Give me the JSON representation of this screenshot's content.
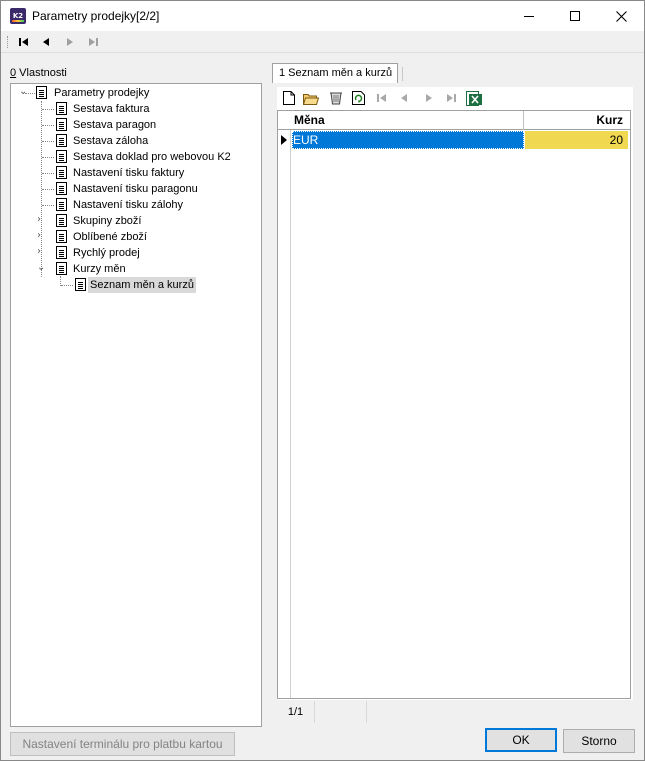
{
  "window": {
    "icon_text": "K2",
    "title": "Parametry prodejky[2/2]"
  },
  "left_panel": {
    "label_accel": "0",
    "label_rest": " Vlastnosti",
    "tree": [
      {
        "label": "Parametry prodejky"
      },
      {
        "label": "Sestava faktura"
      },
      {
        "label": "Sestava paragon"
      },
      {
        "label": "Sestava záloha"
      },
      {
        "label": "Sestava doklad pro webovou K2"
      },
      {
        "label": "Nastavení tisku faktury"
      },
      {
        "label": "Nastavení tisku paragonu"
      },
      {
        "label": "Nastavení tisku zálohy"
      },
      {
        "label": "Skupiny zboží"
      },
      {
        "label": "Oblíbené zboží"
      },
      {
        "label": "Rychlý prodej"
      },
      {
        "label": "Kurzy měn"
      },
      {
        "label": "Seznam měn a kurzů"
      }
    ]
  },
  "tab": {
    "label": "1 Seznam měn a kurzů"
  },
  "grid": {
    "columns": [
      "Měna",
      "Kurz"
    ],
    "rows": [
      {
        "mena": "EUR",
        "kurz": "20"
      }
    ],
    "accent_color": "#0078d7",
    "highlight_color": "#f0d850"
  },
  "status": {
    "position": "1/1"
  },
  "buttons": {
    "terminal": "Nastavení terminálu pro platbu kartou",
    "ok": "OK",
    "cancel": "Storno"
  }
}
